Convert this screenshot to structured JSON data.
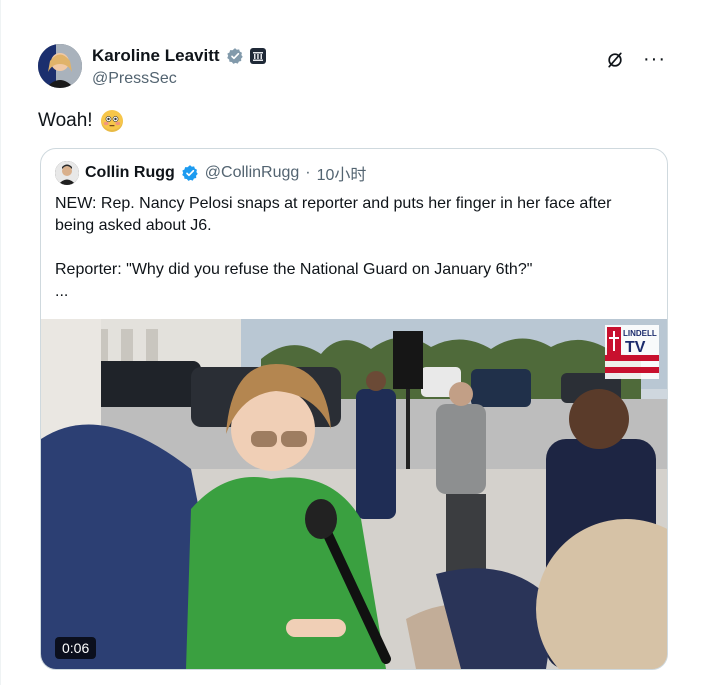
{
  "post": {
    "author_name": "Karoline Leavitt",
    "author_handle": "@PressSec",
    "text": "Woah!",
    "emoji_icon": "flushed-face-icon"
  },
  "quote": {
    "author_name": "Collin Rugg",
    "author_handle": "@CollinRugg",
    "separator": "·",
    "time": "10小时",
    "line1": "NEW: Rep. Nancy Pelosi snaps at reporter and puts her finger in her face after being asked about J6.",
    "line2": "Reporter: \"Why did you refuse the National Guard on January 6th?\"",
    "ellipsis": "...",
    "video_duration": "0:06",
    "logo_top": "LINDELL",
    "logo_bottom": "TV"
  },
  "colors": {
    "verified_blue": "#1d9bf0",
    "text": "#0f1419",
    "secondary": "#536471",
    "border": "#cfd9de",
    "logo_red": "#c8102e"
  }
}
